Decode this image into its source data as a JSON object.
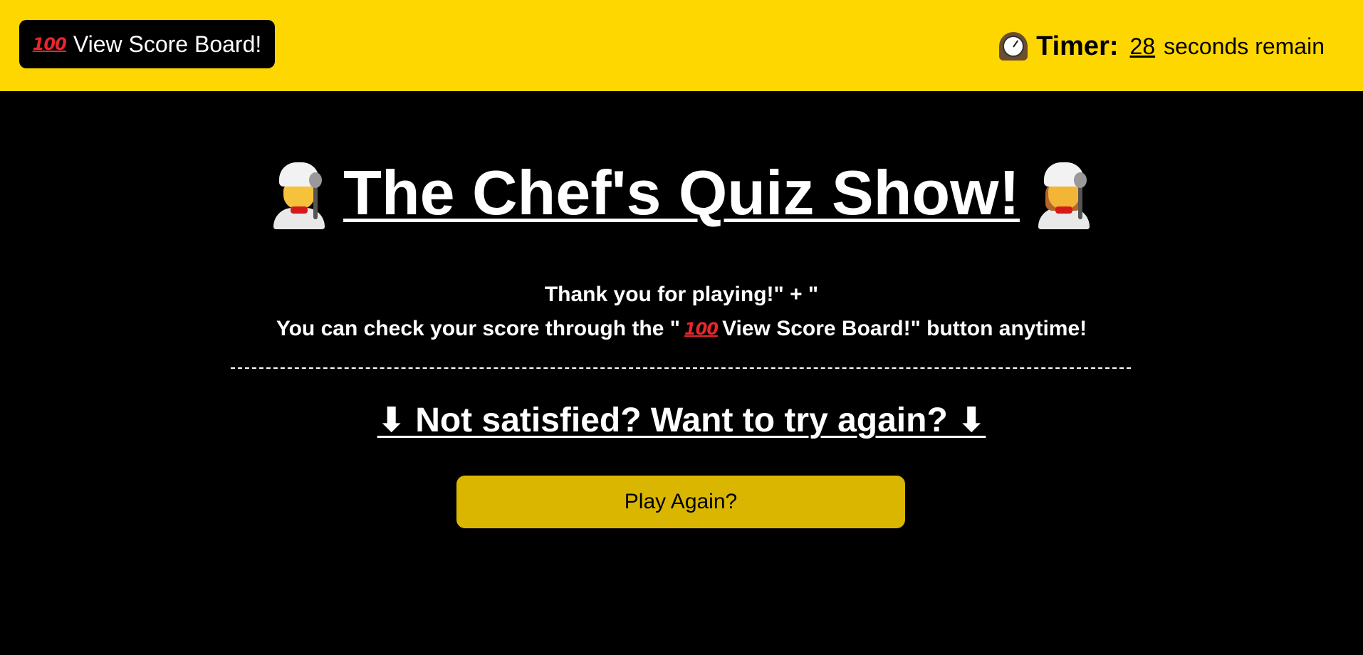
{
  "header": {
    "score_button": {
      "icon": "hundred-points-icon",
      "icon_text": "100",
      "label": "View Score Board!"
    },
    "timer": {
      "icon": "mantelpiece-clock-icon",
      "label": "Timer:",
      "seconds": "28",
      "suffix": "seconds remain"
    }
  },
  "main": {
    "title": {
      "left_icon": "man-cook-icon",
      "text": "The Chef's Quiz Show!",
      "right_icon": "woman-cook-icon"
    },
    "message": {
      "line1": "Thank you for playing!\" + \"",
      "line2_prefix": "You can check your score through the \"",
      "line2_icon_text": "100",
      "line2_suffix": "View Score Board!\" button anytime!"
    },
    "retry_heading": {
      "text": "⬇ Not satisfied? Want to try again? ⬇"
    },
    "play_again_label": "Play Again?"
  },
  "colors": {
    "header_bg": "#FFD700",
    "page_bg": "#000000",
    "play_again_bg": "#DAB600",
    "hundred_red": "#E8262C"
  }
}
